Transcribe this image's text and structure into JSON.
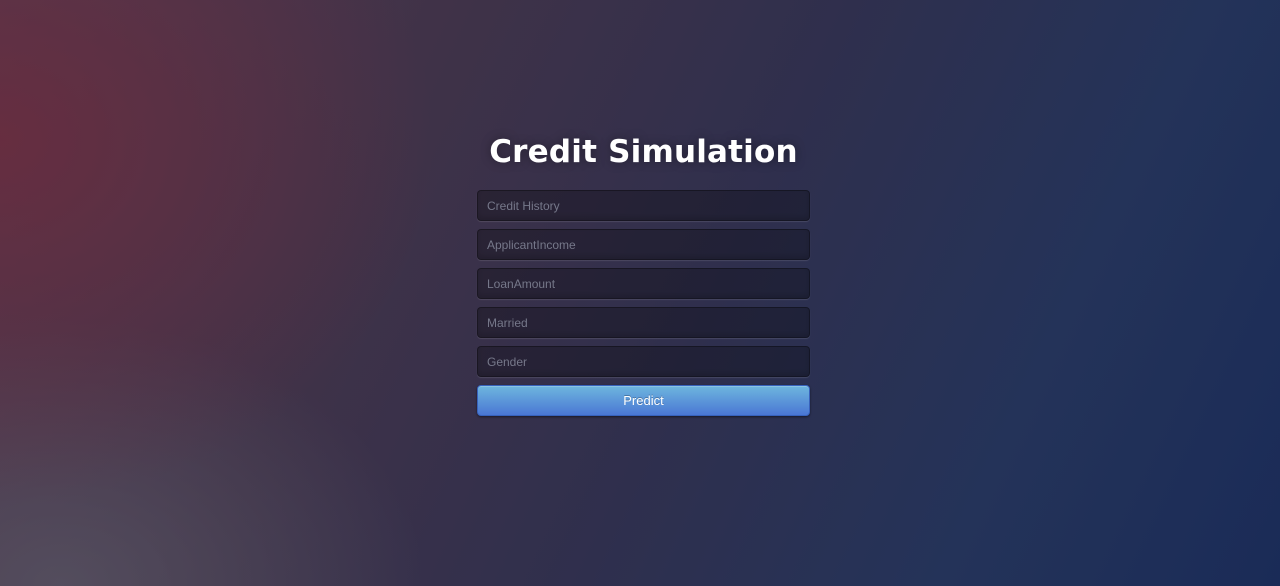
{
  "page": {
    "title": "Credit Simulation"
  },
  "form": {
    "fields": [
      {
        "name": "credit_history",
        "placeholder": "Credit History",
        "value": ""
      },
      {
        "name": "applicant_income",
        "placeholder": "ApplicantIncome",
        "value": ""
      },
      {
        "name": "loan_amount",
        "placeholder": "LoanAmount",
        "value": ""
      },
      {
        "name": "married",
        "placeholder": "Married",
        "value": ""
      },
      {
        "name": "gender",
        "placeholder": "Gender",
        "value": ""
      }
    ],
    "submit_label": "Predict"
  },
  "colors": {
    "button_top": "#6eb6de",
    "button_bottom": "#4a77d4",
    "title": "#ffffff"
  }
}
